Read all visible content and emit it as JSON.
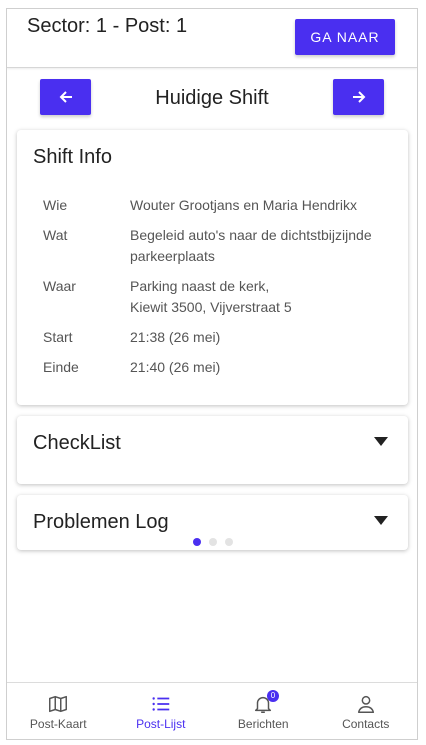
{
  "header": {
    "title": "Sector: 1 - Post: 1",
    "goto_label": "GA NAAR"
  },
  "shift_nav": {
    "label": "Huidige Shift"
  },
  "shift_info": {
    "title": "Shift Info",
    "rows": [
      {
        "key": "Wie",
        "value": "Wouter Grootjans en Maria Hendrikx"
      },
      {
        "key": "Wat",
        "value": "Begeleid auto's naar de dichtstbijzijnde parkeerplaats"
      },
      {
        "key": "Waar",
        "value_line1": "Parking naast de kerk,",
        "value_line2": "Kiewit 3500, Vijverstraat 5"
      },
      {
        "key": "Start",
        "value": "21:38 (26 mei)"
      },
      {
        "key": "Einde",
        "value": "21:40 (26 mei)"
      }
    ]
  },
  "checklist": {
    "title": "CheckList"
  },
  "problem_log": {
    "title": "Problemen Log"
  },
  "carousel": {
    "active_index": 0,
    "count": 3
  },
  "bottom_nav": {
    "items": [
      {
        "label": "Post-Kaart",
        "icon": "map-icon"
      },
      {
        "label": "Post-Lijst",
        "icon": "list-icon",
        "active": true
      },
      {
        "label": "Berichten",
        "icon": "bell-icon",
        "badge": "0"
      },
      {
        "label": "Contacts",
        "icon": "person-icon"
      }
    ]
  },
  "colors": {
    "accent": "#4a2ff0"
  }
}
